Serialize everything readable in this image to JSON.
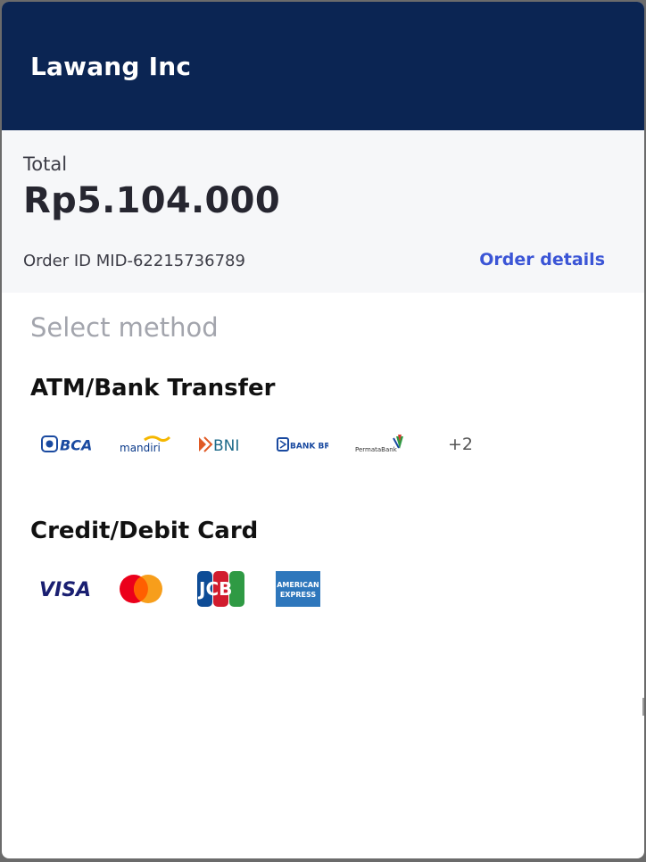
{
  "header": {
    "merchant_name": "Lawang Inc"
  },
  "summary": {
    "total_label": "Total",
    "total_amount": "Rp5.104.000",
    "order_id": "Order ID MID-62215736789",
    "order_details_link": "Order details"
  },
  "methods": {
    "heading": "Select method",
    "bank_transfer": {
      "title": "ATM/Bank Transfer",
      "banks": [
        "BCA",
        "mandiri",
        "BNI",
        "BANK BRI",
        "PermataBank"
      ],
      "more_count": "+2"
    },
    "card": {
      "title": "Credit/Debit Card",
      "networks": [
        "VISA",
        "Mastercard",
        "JCB",
        "AMERICAN EXPRESS"
      ]
    }
  },
  "colors": {
    "header_bg": "#0b2553",
    "link": "#3b55d6",
    "bca": "#1a4aa0",
    "bni": "#e05a25",
    "bri": "#1a4aa0",
    "visa": "#1a1f71",
    "mc_red": "#eb001b",
    "mc_orange": "#f79e1b",
    "amex": "#2e77bc"
  }
}
